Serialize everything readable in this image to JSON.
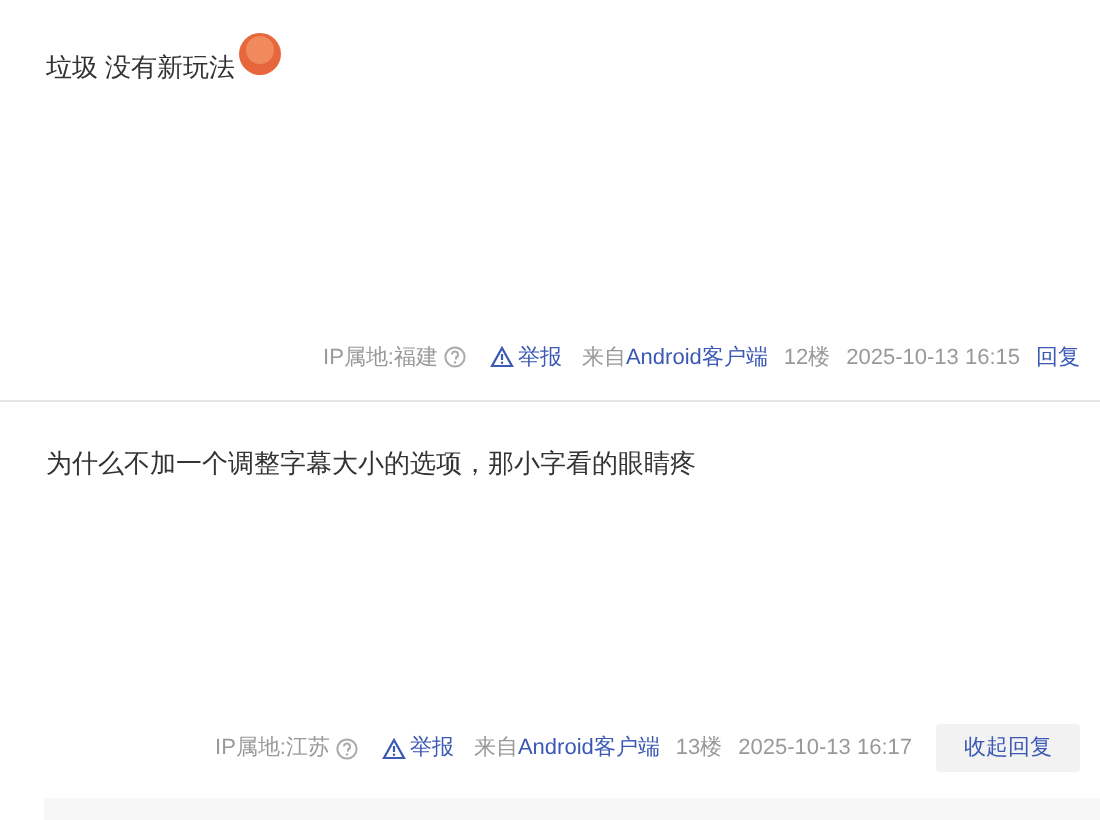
{
  "posts": [
    {
      "content": "垃圾 没有新玩法",
      "emoji": true,
      "ip_location": "IP属地:福建",
      "report": "举报",
      "source": "来自Android客户端",
      "floor": "12楼",
      "time": "2025-10-13 16:15",
      "action": {
        "kind": "link",
        "label": "回复"
      }
    },
    {
      "content": "为什么不加一个调整字幕大小的选项，那小字看的眼睛疼",
      "emoji": false,
      "ip_location": "IP属地:江苏",
      "report": "举报",
      "source": "来自Android客户端",
      "floor": "13楼",
      "time": "2025-10-13 16:17",
      "action": {
        "kind": "button",
        "label": "收起回复"
      }
    }
  ]
}
